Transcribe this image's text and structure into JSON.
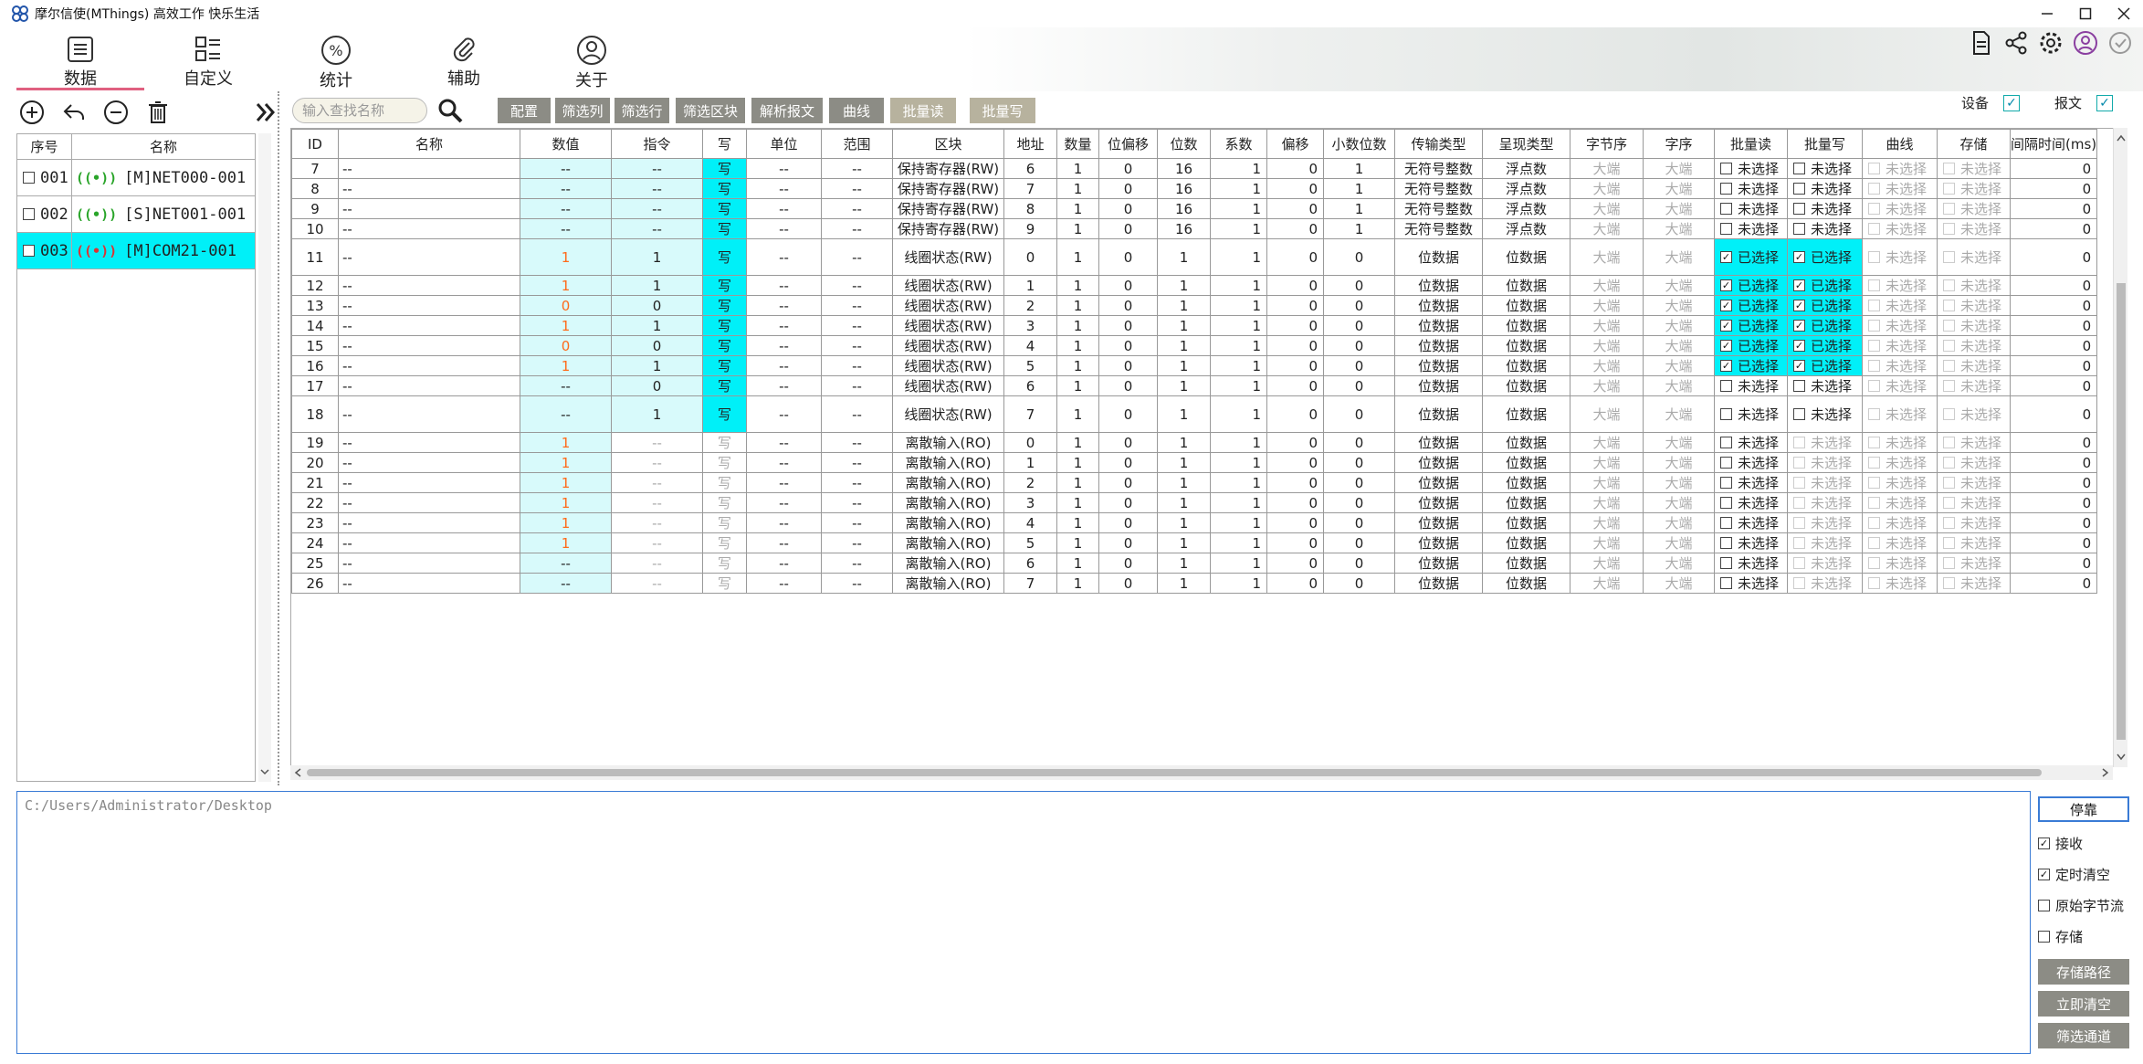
{
  "window": {
    "title": "摩尔信使(MThings) 高效工作 快乐生活",
    "icon_name": "mthings-logo-icon"
  },
  "nav": {
    "items": [
      {
        "label": "数据",
        "icon": "data-list-icon"
      },
      {
        "label": "自定义",
        "icon": "custom-grid-icon"
      },
      {
        "label": "统计",
        "icon": "percent-icon"
      },
      {
        "label": "辅助",
        "icon": "paperclip-icon"
      },
      {
        "label": "关于",
        "icon": "user-circle-icon"
      }
    ],
    "active": "数据"
  },
  "header_toggles": {
    "device_label": "设备",
    "device_checked": true,
    "message_label": "报文",
    "message_checked": true
  },
  "search": {
    "placeholder": "输入查找名称"
  },
  "toolbar": {
    "config": "配置",
    "filter_cols": "筛选列",
    "filter_rows": "筛选行",
    "filter_block": "筛选区块",
    "parse_msg": "解析报文",
    "curve": "曲线",
    "batch_read": "批量读",
    "batch_write": "批量写"
  },
  "device_list": {
    "headers": [
      "序号",
      "名称"
    ],
    "rows": [
      {
        "no": "001",
        "name": "[M]NET000-001",
        "selected": false,
        "status": "green"
      },
      {
        "no": "002",
        "name": "[S]NET001-001",
        "selected": false,
        "status": "green"
      },
      {
        "no": "003",
        "name": "[M]COM21-001",
        "selected": true,
        "status": "red"
      }
    ]
  },
  "table": {
    "headers": [
      "ID",
      "名称",
      "数值",
      "指令",
      "写",
      "单位",
      "范围",
      "区块",
      "地址",
      "数量",
      "位偏移",
      "位数",
      "系数",
      "偏移",
      "小数位数",
      "传输类型",
      "呈现类型",
      "字节序",
      "字序",
      "批量读",
      "批量写",
      "曲线",
      "存储",
      "间隔时间(ms)"
    ],
    "rows": [
      {
        "id": "7",
        "name": "--",
        "value": "--",
        "cmd": "--",
        "w": "写",
        "w_on": true,
        "unit": "--",
        "range": "--",
        "block": "保持寄存器(RW)",
        "addr": "6",
        "qty": "1",
        "bitoff": "0",
        "bits": "16",
        "coef": "1",
        "offset": "0",
        "dec": "1",
        "trans": "无符号整数",
        "present": "浮点数",
        "byte": "大端",
        "word": "大端",
        "br": "未选择",
        "br_on": false,
        "bw": "未选择",
        "bw_on": false,
        "bw_dim": false,
        "curve": "未选择",
        "store": "未选择",
        "interval": "0",
        "tall": false,
        "val_orange": false,
        "cmd_cyan": true
      },
      {
        "id": "8",
        "name": "--",
        "value": "--",
        "cmd": "--",
        "w": "写",
        "w_on": true,
        "unit": "--",
        "range": "--",
        "block": "保持寄存器(RW)",
        "addr": "7",
        "qty": "1",
        "bitoff": "0",
        "bits": "16",
        "coef": "1",
        "offset": "0",
        "dec": "1",
        "trans": "无符号整数",
        "present": "浮点数",
        "byte": "大端",
        "word": "大端",
        "br": "未选择",
        "br_on": false,
        "bw": "未选择",
        "bw_on": false,
        "bw_dim": false,
        "curve": "未选择",
        "store": "未选择",
        "interval": "0",
        "tall": false,
        "val_orange": false,
        "cmd_cyan": true
      },
      {
        "id": "9",
        "name": "--",
        "value": "--",
        "cmd": "--",
        "w": "写",
        "w_on": true,
        "unit": "--",
        "range": "--",
        "block": "保持寄存器(RW)",
        "addr": "8",
        "qty": "1",
        "bitoff": "0",
        "bits": "16",
        "coef": "1",
        "offset": "0",
        "dec": "1",
        "trans": "无符号整数",
        "present": "浮点数",
        "byte": "大端",
        "word": "大端",
        "br": "未选择",
        "br_on": false,
        "bw": "未选择",
        "bw_on": false,
        "bw_dim": false,
        "curve": "未选择",
        "store": "未选择",
        "interval": "0",
        "tall": false,
        "val_orange": false,
        "cmd_cyan": true
      },
      {
        "id": "10",
        "name": "--",
        "value": "--",
        "cmd": "--",
        "w": "写",
        "w_on": true,
        "unit": "--",
        "range": "--",
        "block": "保持寄存器(RW)",
        "addr": "9",
        "qty": "1",
        "bitoff": "0",
        "bits": "16",
        "coef": "1",
        "offset": "0",
        "dec": "1",
        "trans": "无符号整数",
        "present": "浮点数",
        "byte": "大端",
        "word": "大端",
        "br": "未选择",
        "br_on": false,
        "bw": "未选择",
        "bw_on": false,
        "bw_dim": false,
        "curve": "未选择",
        "store": "未选择",
        "interval": "0",
        "tall": false,
        "val_orange": false,
        "cmd_cyan": true
      },
      {
        "id": "11",
        "name": "--",
        "value": "1",
        "cmd": "1",
        "w": "写",
        "w_on": true,
        "unit": "--",
        "range": "--",
        "block": "线圈状态(RW)",
        "addr": "0",
        "qty": "1",
        "bitoff": "0",
        "bits": "1",
        "coef": "1",
        "offset": "0",
        "dec": "0",
        "trans": "位数据",
        "present": "位数据",
        "byte": "大端",
        "word": "大端",
        "br": "已选择",
        "br_on": true,
        "bw": "已选择",
        "bw_on": true,
        "bw_dim": false,
        "curve": "未选择",
        "store": "未选择",
        "interval": "0",
        "tall": true,
        "val_orange": true,
        "cmd_cyan": true
      },
      {
        "id": "12",
        "name": "--",
        "value": "1",
        "cmd": "1",
        "w": "写",
        "w_on": true,
        "unit": "--",
        "range": "--",
        "block": "线圈状态(RW)",
        "addr": "1",
        "qty": "1",
        "bitoff": "0",
        "bits": "1",
        "coef": "1",
        "offset": "0",
        "dec": "0",
        "trans": "位数据",
        "present": "位数据",
        "byte": "大端",
        "word": "大端",
        "br": "已选择",
        "br_on": true,
        "bw": "已选择",
        "bw_on": true,
        "bw_dim": false,
        "curve": "未选择",
        "store": "未选择",
        "interval": "0",
        "tall": false,
        "val_orange": true,
        "cmd_cyan": true
      },
      {
        "id": "13",
        "name": "--",
        "value": "0",
        "cmd": "0",
        "w": "写",
        "w_on": true,
        "unit": "--",
        "range": "--",
        "block": "线圈状态(RW)",
        "addr": "2",
        "qty": "1",
        "bitoff": "0",
        "bits": "1",
        "coef": "1",
        "offset": "0",
        "dec": "0",
        "trans": "位数据",
        "present": "位数据",
        "byte": "大端",
        "word": "大端",
        "br": "已选择",
        "br_on": true,
        "bw": "已选择",
        "bw_on": true,
        "bw_dim": false,
        "curve": "未选择",
        "store": "未选择",
        "interval": "0",
        "tall": false,
        "val_orange": true,
        "cmd_cyan": true
      },
      {
        "id": "14",
        "name": "--",
        "value": "1",
        "cmd": "1",
        "w": "写",
        "w_on": true,
        "unit": "--",
        "range": "--",
        "block": "线圈状态(RW)",
        "addr": "3",
        "qty": "1",
        "bitoff": "0",
        "bits": "1",
        "coef": "1",
        "offset": "0",
        "dec": "0",
        "trans": "位数据",
        "present": "位数据",
        "byte": "大端",
        "word": "大端",
        "br": "已选择",
        "br_on": true,
        "bw": "已选择",
        "bw_on": true,
        "bw_dim": false,
        "curve": "未选择",
        "store": "未选择",
        "interval": "0",
        "tall": false,
        "val_orange": true,
        "cmd_cyan": true
      },
      {
        "id": "15",
        "name": "--",
        "value": "0",
        "cmd": "0",
        "w": "写",
        "w_on": true,
        "unit": "--",
        "range": "--",
        "block": "线圈状态(RW)",
        "addr": "4",
        "qty": "1",
        "bitoff": "0",
        "bits": "1",
        "coef": "1",
        "offset": "0",
        "dec": "0",
        "trans": "位数据",
        "present": "位数据",
        "byte": "大端",
        "word": "大端",
        "br": "已选择",
        "br_on": true,
        "bw": "已选择",
        "bw_on": true,
        "bw_dim": false,
        "curve": "未选择",
        "store": "未选择",
        "interval": "0",
        "tall": false,
        "val_orange": true,
        "cmd_cyan": true
      },
      {
        "id": "16",
        "name": "--",
        "value": "1",
        "cmd": "1",
        "w": "写",
        "w_on": true,
        "unit": "--",
        "range": "--",
        "block": "线圈状态(RW)",
        "addr": "5",
        "qty": "1",
        "bitoff": "0",
        "bits": "1",
        "coef": "1",
        "offset": "0",
        "dec": "0",
        "trans": "位数据",
        "present": "位数据",
        "byte": "大端",
        "word": "大端",
        "br": "已选择",
        "br_on": true,
        "bw": "已选择",
        "bw_on": true,
        "bw_dim": false,
        "curve": "未选择",
        "store": "未选择",
        "interval": "0",
        "tall": false,
        "val_orange": true,
        "cmd_cyan": true
      },
      {
        "id": "17",
        "name": "--",
        "value": "--",
        "cmd": "0",
        "w": "写",
        "w_on": true,
        "unit": "--",
        "range": "--",
        "block": "线圈状态(RW)",
        "addr": "6",
        "qty": "1",
        "bitoff": "0",
        "bits": "1",
        "coef": "1",
        "offset": "0",
        "dec": "0",
        "trans": "位数据",
        "present": "位数据",
        "byte": "大端",
        "word": "大端",
        "br": "未选择",
        "br_on": false,
        "bw": "未选择",
        "bw_on": false,
        "bw_dim": false,
        "curve": "未选择",
        "store": "未选择",
        "interval": "0",
        "tall": false,
        "val_orange": false,
        "cmd_cyan": true
      },
      {
        "id": "18",
        "name": "--",
        "value": "--",
        "cmd": "1",
        "w": "写",
        "w_on": true,
        "unit": "--",
        "range": "--",
        "block": "线圈状态(RW)",
        "addr": "7",
        "qty": "1",
        "bitoff": "0",
        "bits": "1",
        "coef": "1",
        "offset": "0",
        "dec": "0",
        "trans": "位数据",
        "present": "位数据",
        "byte": "大端",
        "word": "大端",
        "br": "未选择",
        "br_on": false,
        "bw": "未选择",
        "bw_on": false,
        "bw_dim": false,
        "curve": "未选择",
        "store": "未选择",
        "interval": "0",
        "tall": true,
        "val_orange": false,
        "cmd_cyan": true
      },
      {
        "id": "19",
        "name": "--",
        "value": "1",
        "cmd": "--",
        "w": "写",
        "w_on": false,
        "unit": "--",
        "range": "--",
        "block": "离散输入(RO)",
        "addr": "0",
        "qty": "1",
        "bitoff": "0",
        "bits": "1",
        "coef": "1",
        "offset": "0",
        "dec": "0",
        "trans": "位数据",
        "present": "位数据",
        "byte": "大端",
        "word": "大端",
        "br": "未选择",
        "br_on": false,
        "bw": "未选择",
        "bw_on": false,
        "bw_dim": true,
        "curve": "未选择",
        "store": "未选择",
        "interval": "0",
        "tall": false,
        "val_orange": true,
        "cmd_cyan": false
      },
      {
        "id": "20",
        "name": "--",
        "value": "1",
        "cmd": "--",
        "w": "写",
        "w_on": false,
        "unit": "--",
        "range": "--",
        "block": "离散输入(RO)",
        "addr": "1",
        "qty": "1",
        "bitoff": "0",
        "bits": "1",
        "coef": "1",
        "offset": "0",
        "dec": "0",
        "trans": "位数据",
        "present": "位数据",
        "byte": "大端",
        "word": "大端",
        "br": "未选择",
        "br_on": false,
        "bw": "未选择",
        "bw_on": false,
        "bw_dim": true,
        "curve": "未选择",
        "store": "未选择",
        "interval": "0",
        "tall": false,
        "val_orange": true,
        "cmd_cyan": false
      },
      {
        "id": "21",
        "name": "--",
        "value": "1",
        "cmd": "--",
        "w": "写",
        "w_on": false,
        "unit": "--",
        "range": "--",
        "block": "离散输入(RO)",
        "addr": "2",
        "qty": "1",
        "bitoff": "0",
        "bits": "1",
        "coef": "1",
        "offset": "0",
        "dec": "0",
        "trans": "位数据",
        "present": "位数据",
        "byte": "大端",
        "word": "大端",
        "br": "未选择",
        "br_on": false,
        "bw": "未选择",
        "bw_on": false,
        "bw_dim": true,
        "curve": "未选择",
        "store": "未选择",
        "interval": "0",
        "tall": false,
        "val_orange": true,
        "cmd_cyan": false
      },
      {
        "id": "22",
        "name": "--",
        "value": "1",
        "cmd": "--",
        "w": "写",
        "w_on": false,
        "unit": "--",
        "range": "--",
        "block": "离散输入(RO)",
        "addr": "3",
        "qty": "1",
        "bitoff": "0",
        "bits": "1",
        "coef": "1",
        "offset": "0",
        "dec": "0",
        "trans": "位数据",
        "present": "位数据",
        "byte": "大端",
        "word": "大端",
        "br": "未选择",
        "br_on": false,
        "bw": "未选择",
        "bw_on": false,
        "bw_dim": true,
        "curve": "未选择",
        "store": "未选择",
        "interval": "0",
        "tall": false,
        "val_orange": true,
        "cmd_cyan": false
      },
      {
        "id": "23",
        "name": "--",
        "value": "1",
        "cmd": "--",
        "w": "写",
        "w_on": false,
        "unit": "--",
        "range": "--",
        "block": "离散输入(RO)",
        "addr": "4",
        "qty": "1",
        "bitoff": "0",
        "bits": "1",
        "coef": "1",
        "offset": "0",
        "dec": "0",
        "trans": "位数据",
        "present": "位数据",
        "byte": "大端",
        "word": "大端",
        "br": "未选择",
        "br_on": false,
        "bw": "未选择",
        "bw_on": false,
        "bw_dim": true,
        "curve": "未选择",
        "store": "未选择",
        "interval": "0",
        "tall": false,
        "val_orange": true,
        "cmd_cyan": false
      },
      {
        "id": "24",
        "name": "--",
        "value": "1",
        "cmd": "--",
        "w": "写",
        "w_on": false,
        "unit": "--",
        "range": "--",
        "block": "离散输入(RO)",
        "addr": "5",
        "qty": "1",
        "bitoff": "0",
        "bits": "1",
        "coef": "1",
        "offset": "0",
        "dec": "0",
        "trans": "位数据",
        "present": "位数据",
        "byte": "大端",
        "word": "大端",
        "br": "未选择",
        "br_on": false,
        "bw": "未选择",
        "bw_on": false,
        "bw_dim": true,
        "curve": "未选择",
        "store": "未选择",
        "interval": "0",
        "tall": false,
        "val_orange": true,
        "cmd_cyan": false
      },
      {
        "id": "25",
        "name": "--",
        "value": "--",
        "cmd": "--",
        "w": "写",
        "w_on": false,
        "unit": "--",
        "range": "--",
        "block": "离散输入(RO)",
        "addr": "6",
        "qty": "1",
        "bitoff": "0",
        "bits": "1",
        "coef": "1",
        "offset": "0",
        "dec": "0",
        "trans": "位数据",
        "present": "位数据",
        "byte": "大端",
        "word": "大端",
        "br": "未选择",
        "br_on": false,
        "bw": "未选择",
        "bw_on": false,
        "bw_dim": true,
        "curve": "未选择",
        "store": "未选择",
        "interval": "0",
        "tall": false,
        "val_orange": false,
        "cmd_cyan": false
      },
      {
        "id": "26",
        "name": "--",
        "value": "--",
        "cmd": "--",
        "w": "写",
        "w_on": false,
        "unit": "--",
        "range": "--",
        "block": "离散输入(RO)",
        "addr": "7",
        "qty": "1",
        "bitoff": "0",
        "bits": "1",
        "coef": "1",
        "offset": "0",
        "dec": "0",
        "trans": "位数据",
        "present": "位数据",
        "byte": "大端",
        "word": "大端",
        "br": "未选择",
        "br_on": false,
        "bw": "未选择",
        "bw_on": false,
        "bw_dim": true,
        "curve": "未选择",
        "store": "未选择",
        "interval": "0",
        "tall": false,
        "val_orange": false,
        "cmd_cyan": false
      }
    ]
  },
  "log": {
    "path": "C:/Users/Administrator/Desktop"
  },
  "log_controls": {
    "dock": "停靠",
    "receive": "接收",
    "receive_checked": true,
    "timed_clear": "定时清空",
    "timed_clear_checked": true,
    "raw_bytes": "原始字节流",
    "raw_bytes_checked": false,
    "store": "存储",
    "store_checked": false,
    "store_path": "存储路径",
    "clear_now": "立即清空",
    "filter_channel": "筛选通道"
  },
  "colors": {
    "cyan": "#00f0f8",
    "cyan_light": "#d8fafb",
    "orange": "#ff6a1a",
    "button_grey": "#8c8c85",
    "accent_blue": "#3a7bd5",
    "nav_underline": "#e06080"
  }
}
